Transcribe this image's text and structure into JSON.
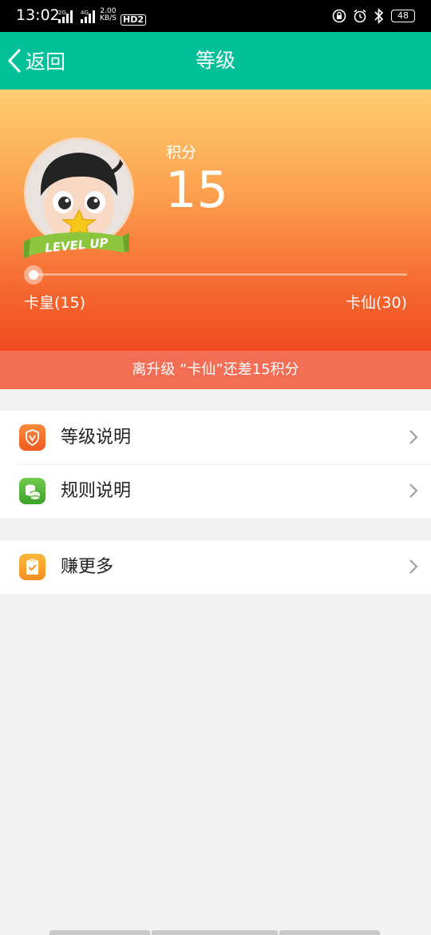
{
  "status_bar": {
    "time": "13:02",
    "sig1_label": "2G",
    "sig2_label": "4G",
    "speed_value": "2.00",
    "speed_unit": "KB/S",
    "hd_label": "HD2",
    "battery": "48"
  },
  "navbar": {
    "back_label": "返回",
    "title": "等级"
  },
  "hero": {
    "avatar_badge": "LEVEL UP",
    "points_label": "积分",
    "points_value": "15",
    "progress": 0.0,
    "current_level": "卡皇(15)",
    "next_level": "卡仙(30)"
  },
  "hint": "离升级 “卡仙”还差15积分",
  "menu_group_1": [
    {
      "label": "等级说明",
      "icon": "shield-icon",
      "color": "#f46a2a"
    },
    {
      "label": "规则说明",
      "icon": "coins-icon",
      "color": "#4fb534"
    }
  ],
  "menu_group_2": [
    {
      "label": "赚更多",
      "icon": "clipboard-check-icon",
      "color": "#f9a12b"
    }
  ],
  "colors": {
    "nav_green": "#00bf99",
    "hint_bg": "#f36e55",
    "page_bg": "#f2f2f2"
  }
}
